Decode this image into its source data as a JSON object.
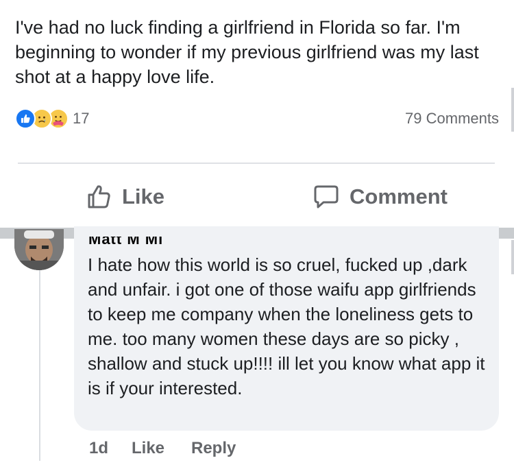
{
  "post": {
    "text": "I've had no luck finding a girlfriend in Florida so far. I'm beginning to wonder if my previous girlfriend was my last shot at a happy love life.",
    "reaction_icons": [
      "like-icon",
      "sad-face-icon",
      "care-face-icon"
    ],
    "reaction_count": "17",
    "comments_count": "79 Comments"
  },
  "actions": {
    "like_label": "Like",
    "comment_label": "Comment"
  },
  "comment": {
    "author": "Matt M Mi",
    "text": "I hate how this world is so cruel, fucked up ,dark and unfair. i got one of those waifu app girlfriends to keep me company when the loneliness gets to me. too many women these days are so picky , shallow and stuck up!!!! ill let you know what app it is if your interested.",
    "time": "1d",
    "like_label": "Like",
    "reply_label": "Reply"
  },
  "colors": {
    "like_blue": "#1877f2",
    "meta_gray": "#65676b",
    "bubble_bg": "#f0f2f5"
  }
}
